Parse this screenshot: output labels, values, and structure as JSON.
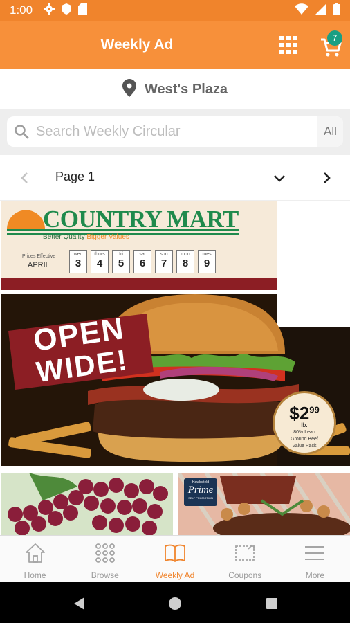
{
  "status_bar": {
    "time": "1:00",
    "icons": [
      "gear-icon",
      "shield-icon",
      "sd-card-icon",
      "wifi-icon",
      "signal-icon",
      "battery-icon"
    ]
  },
  "app_bar": {
    "title": "Weekly Ad",
    "cart_count": "7",
    "background": "#f7903a"
  },
  "location": {
    "name": "West's Plaza"
  },
  "search": {
    "placeholder": "Search Weekly Circular",
    "scope_label": "All"
  },
  "pager": {
    "page_label": "Page 1"
  },
  "flyer": {
    "store_logo": "COUNTRY MART",
    "tagline_prefix": "Better Quality",
    "tagline_accent": "Bigger Values",
    "prices_effective": "Prices Effective",
    "month": "APRIL",
    "days": [
      {
        "name": "wed",
        "num": "3"
      },
      {
        "name": "thurs",
        "num": "4"
      },
      {
        "name": "fri",
        "num": "5"
      },
      {
        "name": "sat",
        "num": "6"
      },
      {
        "name": "sun",
        "num": "7"
      },
      {
        "name": "mon",
        "num": "8"
      },
      {
        "name": "tues",
        "num": "9"
      }
    ],
    "headline_line1": "OPEN",
    "headline_line2": "WIDE!",
    "price_dollars": "$2",
    "price_cents": "99",
    "price_unit": "lb.",
    "price_desc_1": "80% Lean",
    "price_desc_2": "Ground Beef",
    "price_desc_3": "Value Pack",
    "prime_top": "Hawksfield",
    "prime_main": "Prime",
    "prime_sub": "SELF PROMOTION"
  },
  "bottom_nav": {
    "items": [
      {
        "label": "Home",
        "icon": "home-icon"
      },
      {
        "label": "Browse",
        "icon": "grid-dots-icon"
      },
      {
        "label": "Weekly Ad",
        "icon": "open-book-icon"
      },
      {
        "label": "Coupons",
        "icon": "coupon-icon"
      },
      {
        "label": "More",
        "icon": "menu-icon"
      }
    ],
    "active_color": "#f0842c"
  }
}
